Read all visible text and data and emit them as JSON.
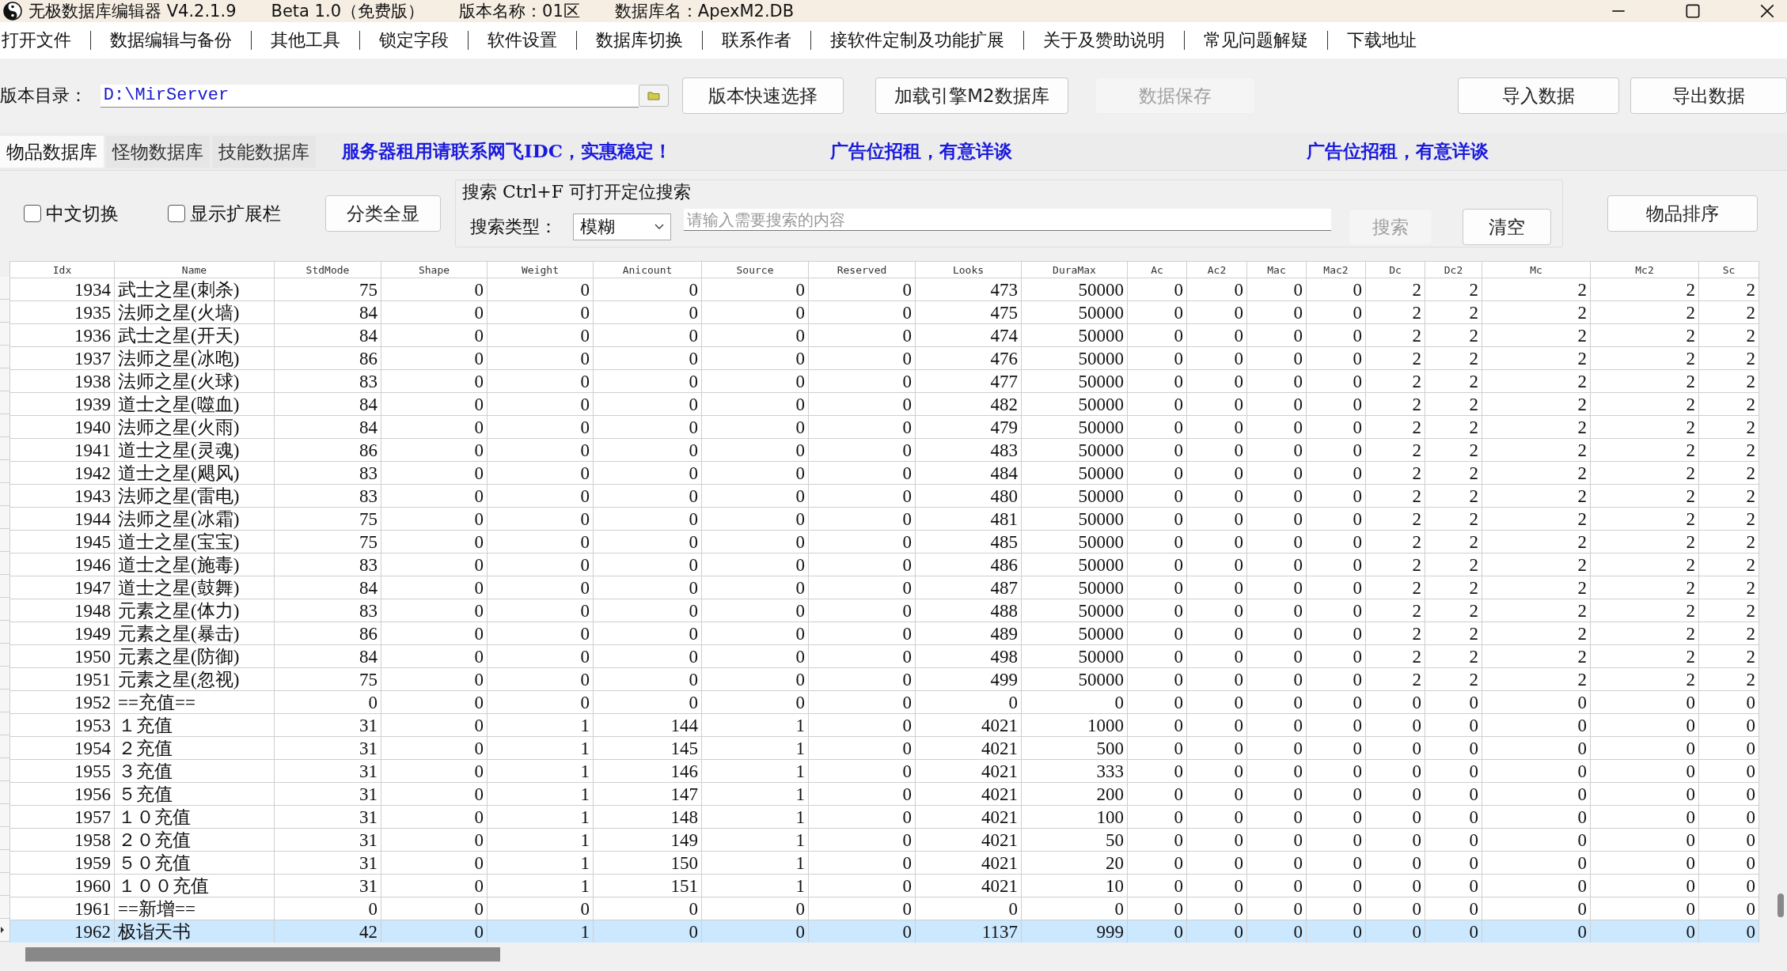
{
  "title_bar": {
    "texts": [
      "无极数据库编辑器 V4.2.1.9",
      "Beta 1.0（免费版）",
      "版本名称：01区",
      "数据库名：ApexM2.DB"
    ]
  },
  "menu": [
    "打开文件",
    "数据编辑与备份",
    "其他工具",
    "锁定字段",
    "软件设置",
    "数据库切换",
    "联系作者",
    "接软件定制及功能扩展",
    "关于及赞助说明",
    "常见问题解疑",
    "下载地址"
  ],
  "path_row": {
    "label": "版本目录：",
    "value": "D:\\MirServer",
    "buttons": [
      {
        "label": "版本快速选择",
        "disabled": false
      },
      {
        "label": "加载引擎M2数据库",
        "disabled": false
      },
      {
        "label": "数据保存",
        "disabled": true
      },
      {
        "label": "导入数据",
        "disabled": false
      },
      {
        "label": "导出数据",
        "disabled": false
      }
    ]
  },
  "tabs": [
    {
      "label": "物品数据库",
      "selected": true
    },
    {
      "label": "怪物数据库",
      "selected": false
    },
    {
      "label": "技能数据库",
      "selected": false
    }
  ],
  "ads": [
    "服务器租用请联系网飞IDC，实惠稳定！",
    "广告位招租，有意详谈",
    "广告位招租，有意详谈"
  ],
  "options": {
    "checkboxes": [
      {
        "label": "中文切换",
        "checked": false
      },
      {
        "label": "显示扩展栏",
        "checked": false
      }
    ],
    "button": "分类全显"
  },
  "search": {
    "title": "搜索  Ctrl+F 可打开定位搜索",
    "type_label": "搜索类型：",
    "type_value": "模糊",
    "placeholder": "请输入需要搜索的内容",
    "buttons": [
      {
        "label": "搜索",
        "disabled": true
      },
      {
        "label": "清空",
        "disabled": false
      }
    ]
  },
  "sort_button": "物品排序",
  "table": {
    "columns": [
      "Idx",
      "Name",
      "StdMode",
      "Shape",
      "Weight",
      "Anicount",
      "Source",
      "Reserved",
      "Looks",
      "DuraMax",
      "Ac",
      "Ac2",
      "Mac",
      "Mac2",
      "Dc",
      "Dc2",
      "Mc",
      "Mc2",
      "Sc"
    ],
    "rows": [
      {
        "selected": false,
        "cells": [
          "1934",
          "武士之星(刺杀)",
          "75",
          "0",
          "0",
          "0",
          "0",
          "0",
          "473",
          "50000",
          "0",
          "0",
          "0",
          "0",
          "2",
          "2",
          "2",
          "2",
          "2"
        ]
      },
      {
        "selected": false,
        "cells": [
          "1935",
          "法师之星(火墙)",
          "84",
          "0",
          "0",
          "0",
          "0",
          "0",
          "475",
          "50000",
          "0",
          "0",
          "0",
          "0",
          "2",
          "2",
          "2",
          "2",
          "2"
        ]
      },
      {
        "selected": false,
        "cells": [
          "1936",
          "武士之星(开天)",
          "84",
          "0",
          "0",
          "0",
          "0",
          "0",
          "474",
          "50000",
          "0",
          "0",
          "0",
          "0",
          "2",
          "2",
          "2",
          "2",
          "2"
        ]
      },
      {
        "selected": false,
        "cells": [
          "1937",
          "法师之星(冰咆)",
          "86",
          "0",
          "0",
          "0",
          "0",
          "0",
          "476",
          "50000",
          "0",
          "0",
          "0",
          "0",
          "2",
          "2",
          "2",
          "2",
          "2"
        ]
      },
      {
        "selected": false,
        "cells": [
          "1938",
          "法师之星(火球)",
          "83",
          "0",
          "0",
          "0",
          "0",
          "0",
          "477",
          "50000",
          "0",
          "0",
          "0",
          "0",
          "2",
          "2",
          "2",
          "2",
          "2"
        ]
      },
      {
        "selected": false,
        "cells": [
          "1939",
          "道士之星(噬血)",
          "84",
          "0",
          "0",
          "0",
          "0",
          "0",
          "482",
          "50000",
          "0",
          "0",
          "0",
          "0",
          "2",
          "2",
          "2",
          "2",
          "2"
        ]
      },
      {
        "selected": false,
        "cells": [
          "1940",
          "法师之星(火雨)",
          "84",
          "0",
          "0",
          "0",
          "0",
          "0",
          "479",
          "50000",
          "0",
          "0",
          "0",
          "0",
          "2",
          "2",
          "2",
          "2",
          "2"
        ]
      },
      {
        "selected": false,
        "cells": [
          "1941",
          "道士之星(灵魂)",
          "86",
          "0",
          "0",
          "0",
          "0",
          "0",
          "483",
          "50000",
          "0",
          "0",
          "0",
          "0",
          "2",
          "2",
          "2",
          "2",
          "2"
        ]
      },
      {
        "selected": false,
        "cells": [
          "1942",
          "道士之星(飓风)",
          "83",
          "0",
          "0",
          "0",
          "0",
          "0",
          "484",
          "50000",
          "0",
          "0",
          "0",
          "0",
          "2",
          "2",
          "2",
          "2",
          "2"
        ]
      },
      {
        "selected": false,
        "cells": [
          "1943",
          "法师之星(雷电)",
          "83",
          "0",
          "0",
          "0",
          "0",
          "0",
          "480",
          "50000",
          "0",
          "0",
          "0",
          "0",
          "2",
          "2",
          "2",
          "2",
          "2"
        ]
      },
      {
        "selected": false,
        "cells": [
          "1944",
          "法师之星(冰霜)",
          "75",
          "0",
          "0",
          "0",
          "0",
          "0",
          "481",
          "50000",
          "0",
          "0",
          "0",
          "0",
          "2",
          "2",
          "2",
          "2",
          "2"
        ]
      },
      {
        "selected": false,
        "cells": [
          "1945",
          "道士之星(宝宝)",
          "75",
          "0",
          "0",
          "0",
          "0",
          "0",
          "485",
          "50000",
          "0",
          "0",
          "0",
          "0",
          "2",
          "2",
          "2",
          "2",
          "2"
        ]
      },
      {
        "selected": false,
        "cells": [
          "1946",
          "道士之星(施毒)",
          "83",
          "0",
          "0",
          "0",
          "0",
          "0",
          "486",
          "50000",
          "0",
          "0",
          "0",
          "0",
          "2",
          "2",
          "2",
          "2",
          "2"
        ]
      },
      {
        "selected": false,
        "cells": [
          "1947",
          "道士之星(鼓舞)",
          "84",
          "0",
          "0",
          "0",
          "0",
          "0",
          "487",
          "50000",
          "0",
          "0",
          "0",
          "0",
          "2",
          "2",
          "2",
          "2",
          "2"
        ]
      },
      {
        "selected": false,
        "cells": [
          "1948",
          "元素之星(体力)",
          "83",
          "0",
          "0",
          "0",
          "0",
          "0",
          "488",
          "50000",
          "0",
          "0",
          "0",
          "0",
          "2",
          "2",
          "2",
          "2",
          "2"
        ]
      },
      {
        "selected": false,
        "cells": [
          "1949",
          "元素之星(暴击)",
          "86",
          "0",
          "0",
          "0",
          "0",
          "0",
          "489",
          "50000",
          "0",
          "0",
          "0",
          "0",
          "2",
          "2",
          "2",
          "2",
          "2"
        ]
      },
      {
        "selected": false,
        "cells": [
          "1950",
          "元素之星(防御)",
          "84",
          "0",
          "0",
          "0",
          "0",
          "0",
          "498",
          "50000",
          "0",
          "0",
          "0",
          "0",
          "2",
          "2",
          "2",
          "2",
          "2"
        ]
      },
      {
        "selected": false,
        "cells": [
          "1951",
          "元素之星(忽视)",
          "75",
          "0",
          "0",
          "0",
          "0",
          "0",
          "499",
          "50000",
          "0",
          "0",
          "0",
          "0",
          "2",
          "2",
          "2",
          "2",
          "2"
        ]
      },
      {
        "selected": false,
        "cells": [
          "1952",
          "==充值==",
          "0",
          "0",
          "0",
          "0",
          "0",
          "0",
          "0",
          "0",
          "0",
          "0",
          "0",
          "0",
          "0",
          "0",
          "0",
          "0",
          "0"
        ]
      },
      {
        "selected": false,
        "cells": [
          "1953",
          "１充值",
          "31",
          "0",
          "1",
          "144",
          "1",
          "0",
          "4021",
          "1000",
          "0",
          "0",
          "0",
          "0",
          "0",
          "0",
          "0",
          "0",
          "0"
        ]
      },
      {
        "selected": false,
        "cells": [
          "1954",
          "２充值",
          "31",
          "0",
          "1",
          "145",
          "1",
          "0",
          "4021",
          "500",
          "0",
          "0",
          "0",
          "0",
          "0",
          "0",
          "0",
          "0",
          "0"
        ]
      },
      {
        "selected": false,
        "cells": [
          "1955",
          "３充值",
          "31",
          "0",
          "1",
          "146",
          "1",
          "0",
          "4021",
          "333",
          "0",
          "0",
          "0",
          "0",
          "0",
          "0",
          "0",
          "0",
          "0"
        ]
      },
      {
        "selected": false,
        "cells": [
          "1956",
          "５充值",
          "31",
          "0",
          "1",
          "147",
          "1",
          "0",
          "4021",
          "200",
          "0",
          "0",
          "0",
          "0",
          "0",
          "0",
          "0",
          "0",
          "0"
        ]
      },
      {
        "selected": false,
        "cells": [
          "1957",
          "１０充值",
          "31",
          "0",
          "1",
          "148",
          "1",
          "0",
          "4021",
          "100",
          "0",
          "0",
          "0",
          "0",
          "0",
          "0",
          "0",
          "0",
          "0"
        ]
      },
      {
        "selected": false,
        "cells": [
          "1958",
          "２０充值",
          "31",
          "0",
          "1",
          "149",
          "1",
          "0",
          "4021",
          "50",
          "0",
          "0",
          "0",
          "0",
          "0",
          "0",
          "0",
          "0",
          "0"
        ]
      },
      {
        "selected": false,
        "cells": [
          "1959",
          "５０充值",
          "31",
          "0",
          "1",
          "150",
          "1",
          "0",
          "4021",
          "20",
          "0",
          "0",
          "0",
          "0",
          "0",
          "0",
          "0",
          "0",
          "0"
        ]
      },
      {
        "selected": false,
        "cells": [
          "1960",
          "１００充值",
          "31",
          "0",
          "1",
          "151",
          "1",
          "0",
          "4021",
          "10",
          "0",
          "0",
          "0",
          "0",
          "0",
          "0",
          "0",
          "0",
          "0"
        ]
      },
      {
        "selected": false,
        "cells": [
          "1961",
          "==新增==",
          "0",
          "0",
          "0",
          "0",
          "0",
          "0",
          "0",
          "0",
          "0",
          "0",
          "0",
          "0",
          "0",
          "0",
          "0",
          "0",
          "0"
        ]
      },
      {
        "selected": true,
        "cells": [
          "1962",
          "极诣天书",
          "42",
          "0",
          "1",
          "0",
          "0",
          "0",
          "1137",
          "999",
          "0",
          "0",
          "0",
          "0",
          "0",
          "0",
          "0",
          "0",
          "0"
        ]
      }
    ]
  }
}
